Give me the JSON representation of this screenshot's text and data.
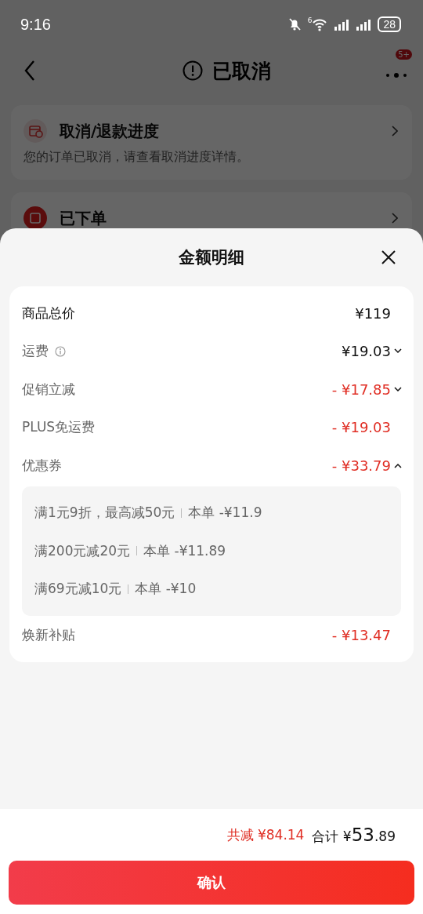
{
  "status_bar": {
    "time": "9:16",
    "wifi_label": "6",
    "battery": "28"
  },
  "nav": {
    "title": "已取消",
    "badge": "5+"
  },
  "cards": [
    {
      "title": "取消/退款进度",
      "subtitle": "您的订单已取消，请查看取消进度详情。"
    },
    {
      "title": "已下单"
    }
  ],
  "sheet": {
    "title": "金额明细",
    "rows": [
      {
        "kind": "total",
        "label": "商品总价",
        "value": "¥119",
        "negative": false
      },
      {
        "kind": "line",
        "label": "运费",
        "info": true,
        "value": "¥19.03",
        "negative": false,
        "expanded": false
      },
      {
        "kind": "line",
        "label": "促销立减",
        "value": "- ¥17.85",
        "negative": true,
        "expanded": false
      },
      {
        "kind": "line",
        "label": "PLUS免运费",
        "value": "- ¥19.03",
        "negative": true
      },
      {
        "kind": "line",
        "label": "优惠券",
        "value": "- ¥33.79",
        "negative": true,
        "expanded": true,
        "details": [
          {
            "rule": "满1元9折，最高减50元",
            "amount": "本单 -¥11.9"
          },
          {
            "rule": "满200元减20元",
            "amount": "本单 -¥11.89"
          },
          {
            "rule": "满69元减10元",
            "amount": "本单 -¥10"
          }
        ]
      },
      {
        "kind": "line",
        "label": "焕新补贴",
        "value": "- ¥13.47",
        "negative": true
      }
    ],
    "footer": {
      "saved": "共减 ¥84.14",
      "total_label": "合计 ¥",
      "total_int": "53",
      "total_dec": ".89"
    },
    "button": "确认"
  }
}
